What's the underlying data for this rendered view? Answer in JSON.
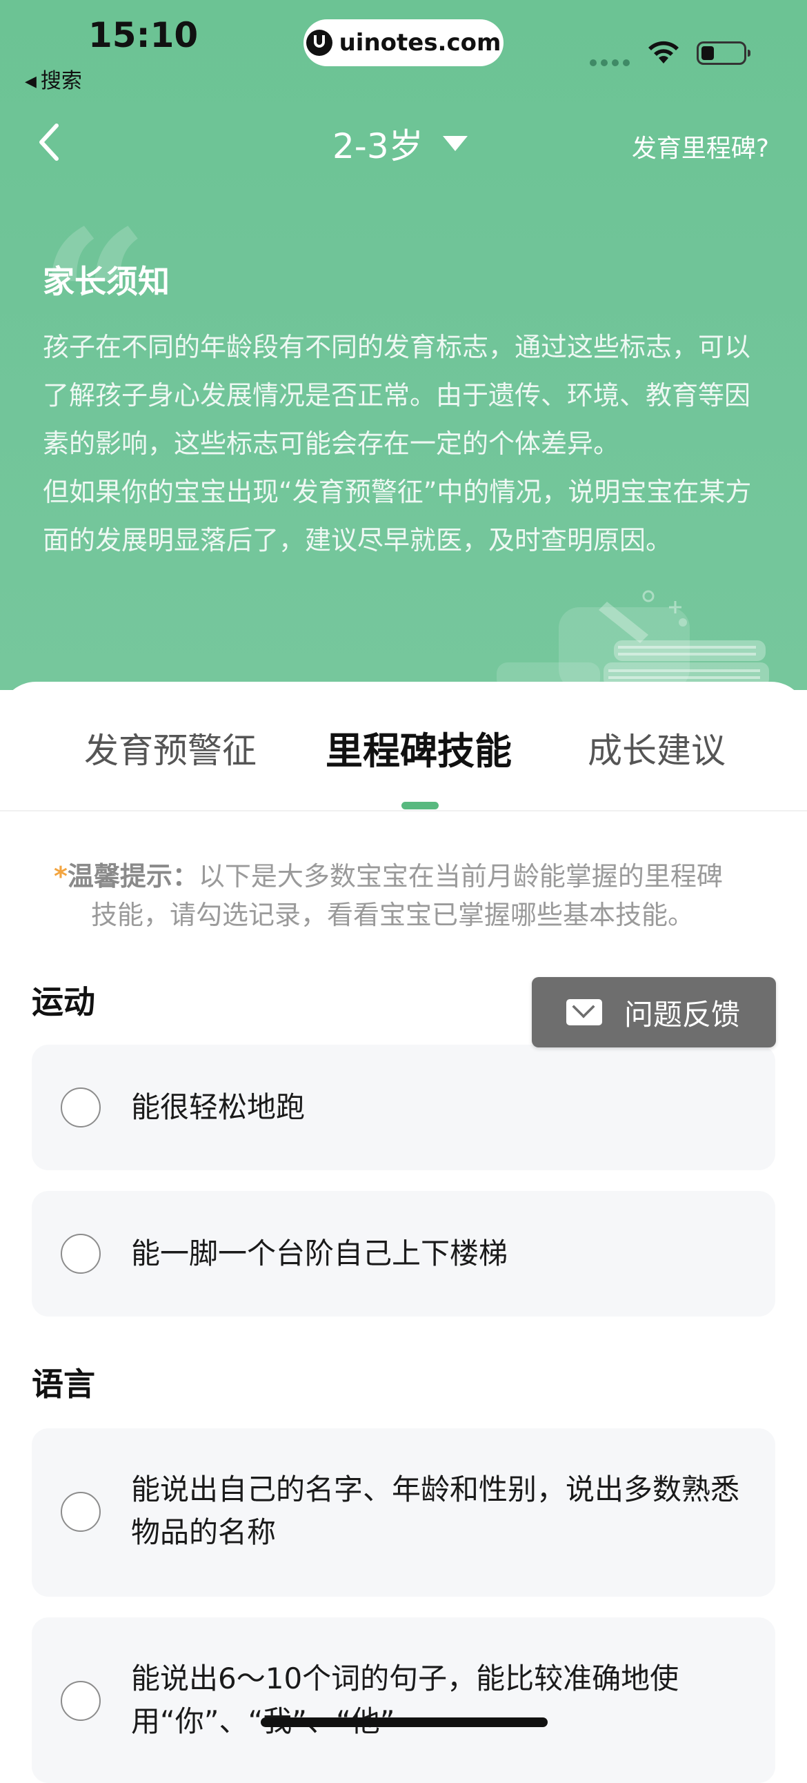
{
  "status_bar": {
    "time": "15:10",
    "back_app": "搜索",
    "url": "uinotes.com"
  },
  "nav": {
    "title": "2-3岁",
    "right_link": "发育里程碑?"
  },
  "notice": {
    "title": "家长须知",
    "paragraph1": "孩子在不同的年龄段有不同的发育标志，通过这些标志，可以了解孩子身心发展情况是否正常。由于遗传、环境、教育等因素的影响，这些标志可能会存在一定的个体差异。",
    "paragraph2": "但如果你的宝宝出现“发育预警征”中的情况，说明宝宝在某方面的发展明显落后了，建议尽早就医，及时查明原因。"
  },
  "tabs": [
    {
      "label": "发育预警征",
      "active": false
    },
    {
      "label": "里程碑技能",
      "active": true
    },
    {
      "label": "成长建议",
      "active": false
    }
  ],
  "tip": {
    "star": "*",
    "label": "温馨提示：",
    "line1": "以下是大多数宝宝在当前月龄能掌握的里程碑",
    "line2": "技能，请勾选记录，看看宝宝已掌握哪些基本技能。"
  },
  "sections": [
    {
      "title": "运动",
      "items": [
        "能很轻松地跑",
        "能一脚一个台阶自己上下楼梯"
      ]
    },
    {
      "title": "语言",
      "items": [
        "能说出自己的名字、年龄和性别，说出多数熟悉物品的名称",
        "能说出6～10个词的句子，能比较准确地使用“你”、“我”、“他”"
      ]
    }
  ],
  "feedback": {
    "label": "问题反馈",
    "icon": "mail-icon"
  },
  "colors": {
    "header_green": "#6cc394",
    "indicator_green": "#58b97f",
    "tip_star": "#f3a540",
    "feedback_bg": "#6e6e6e"
  }
}
